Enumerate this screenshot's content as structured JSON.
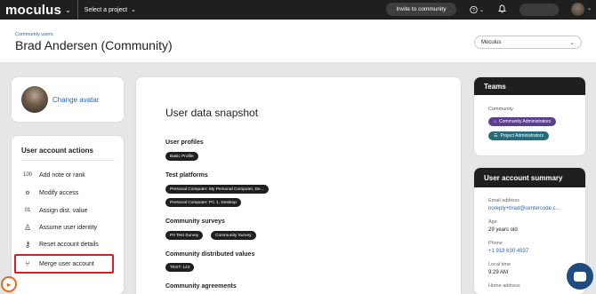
{
  "topbar": {
    "logo": "moculus",
    "project_select": "Select a project",
    "invite_button": "Invite to community",
    "icons": [
      "chevron-down-icon",
      "help-icon",
      "bell-icon",
      "search-icon",
      "avatar"
    ]
  },
  "header": {
    "breadcrumb": "Community users",
    "title": "Brad Andersen (Community)",
    "org_select": "Moculus"
  },
  "avatar_card": {
    "change_avatar": "Change avatar"
  },
  "actions": {
    "title": "User account actions",
    "items": [
      {
        "label": "Add note or rank",
        "icon": "note-icon",
        "glyph": "100"
      },
      {
        "label": "Modify access",
        "icon": "access-icon",
        "glyph": "⚙"
      },
      {
        "label": "Assign dist. value",
        "icon": "binary-icon",
        "glyph": "01"
      },
      {
        "label": "Assume user identity",
        "icon": "user-identity-icon",
        "glyph": "♙"
      },
      {
        "label": "Reset account details",
        "icon": "key-icon",
        "glyph": "⚷"
      },
      {
        "label": "Merge user account",
        "icon": "merge-icon",
        "glyph": "⑂"
      }
    ]
  },
  "snapshot": {
    "title": "User data snapshot",
    "sections": {
      "profiles": "User profiles",
      "platforms": "Test platforms",
      "surveys": "Community surveys",
      "dist_values": "Community distributed values",
      "agreements": "Community agreements"
    },
    "profile_chips": [
      "Basic Profile"
    ],
    "platform_chips": [
      "Personal Computer: My Personal Computer, De...",
      "Personal Computer: PC 1, Desktop"
    ],
    "survey_chips": [
      "PII Test Survey",
      "Community Survey"
    ],
    "dist_value_chips": [
      "TEST: 123"
    ]
  },
  "teams": {
    "title": "Teams",
    "subtitle": "Community",
    "items": [
      {
        "label": "Community Administrators",
        "color": "#5b3f8c",
        "icon": "home-icon"
      },
      {
        "label": "Project Administrators",
        "color": "#2a6b7a",
        "icon": "list-icon"
      }
    ]
  },
  "summary": {
    "title": "User account summary",
    "email_label": "Email address",
    "email": "noreply+brad@centercode.c...",
    "age_label": "Age",
    "age": "29 years old",
    "phone_label": "Phone",
    "phone": "+1 918 630 4937",
    "time_label": "Local time",
    "time": "9:29 AM",
    "home_label": "Home address"
  }
}
